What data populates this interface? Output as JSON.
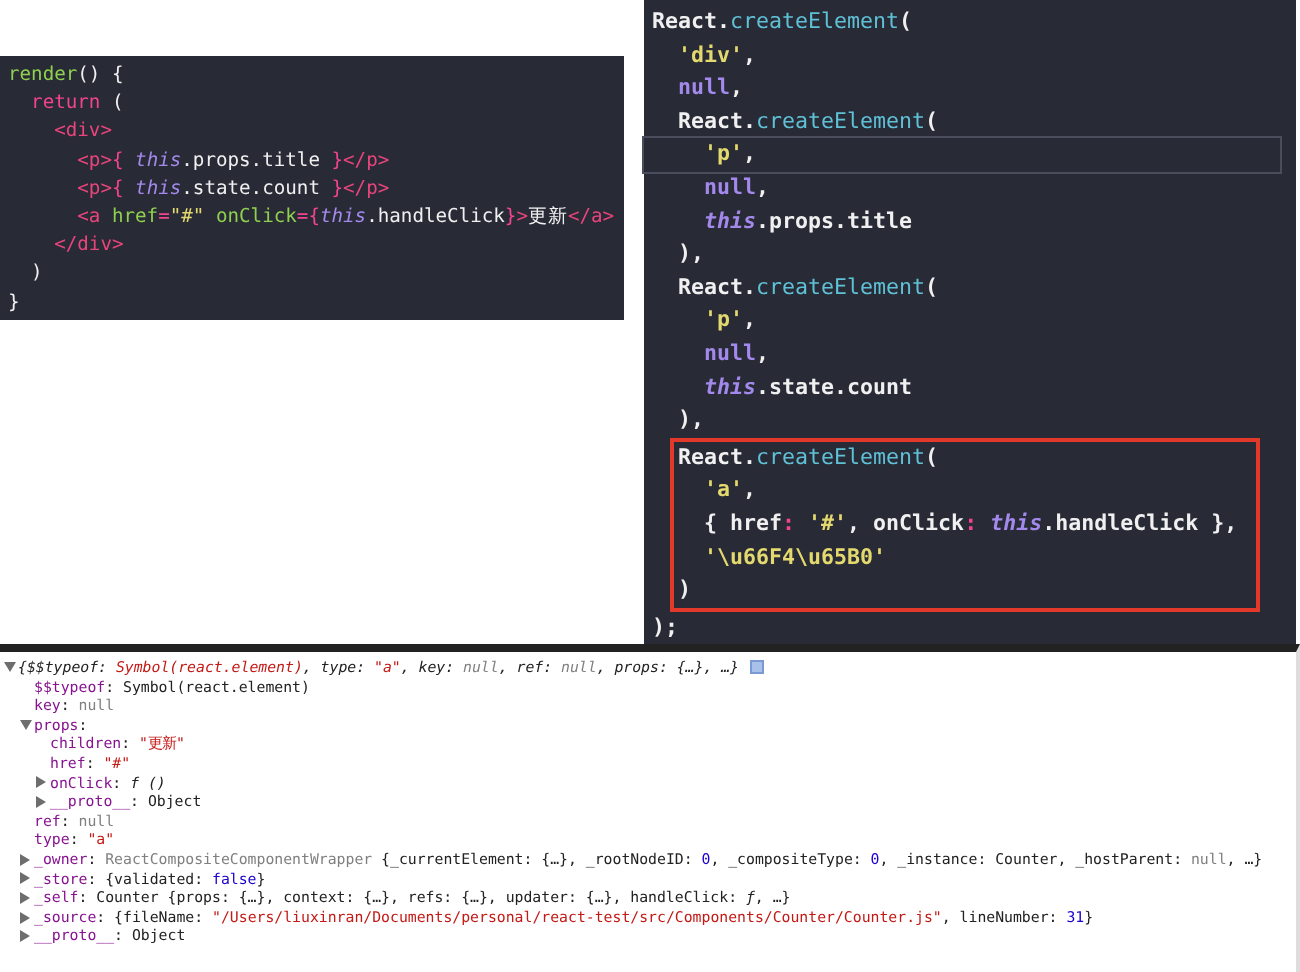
{
  "jsx_code": {
    "lines": [
      [
        {
          "kind": "f",
          "text": "render"
        },
        {
          "kind": "p",
          "text": "() {"
        }
      ],
      [
        {
          "kind": "k",
          "text": "  return"
        },
        {
          "kind": "p",
          "text": " ("
        }
      ],
      [
        {
          "kind": "t",
          "text": "    <div>"
        }
      ],
      [
        {
          "kind": "t",
          "text": "      <p>"
        },
        {
          "kind": "k",
          "text": "{ "
        },
        {
          "kind": "b",
          "text": "this"
        },
        {
          "kind": "p",
          "text": ".props.title "
        },
        {
          "kind": "k",
          "text": "}"
        },
        {
          "kind": "t",
          "text": "</p>"
        }
      ],
      [
        {
          "kind": "t",
          "text": "      <p>"
        },
        {
          "kind": "k",
          "text": "{ "
        },
        {
          "kind": "b",
          "text": "this"
        },
        {
          "kind": "p",
          "text": ".state.count "
        },
        {
          "kind": "k",
          "text": "}"
        },
        {
          "kind": "t",
          "text": "</p>"
        }
      ],
      [
        {
          "kind": "t",
          "text": "      <a "
        },
        {
          "kind": "a",
          "text": "href"
        },
        {
          "kind": "k",
          "text": "="
        },
        {
          "kind": "s",
          "text": "\"#\" "
        },
        {
          "kind": "a",
          "text": "onClick"
        },
        {
          "kind": "k",
          "text": "={"
        },
        {
          "kind": "b",
          "text": "this"
        },
        {
          "kind": "p",
          "text": ".handleClick"
        },
        {
          "kind": "k",
          "text": "}"
        },
        {
          "kind": "t",
          "text": ">"
        },
        {
          "kind": "p",
          "text": "更新"
        },
        {
          "kind": "t",
          "text": "</a>"
        }
      ],
      [
        {
          "kind": "t",
          "text": "    </div>"
        }
      ],
      [
        {
          "kind": "p",
          "text": "  )"
        }
      ],
      [
        {
          "kind": "p",
          "text": "}"
        }
      ]
    ]
  },
  "compiled_code": {
    "lines_before": [
      {
        "current": false,
        "tokens": [
          {
            "kind": "p",
            "text": "React."
          },
          {
            "kind": "c",
            "text": "createElement"
          },
          {
            "kind": "p",
            "text": "("
          }
        ]
      },
      {
        "current": false,
        "tokens": [
          {
            "kind": "s",
            "text": "  'div'"
          },
          {
            "kind": "p",
            "text": ","
          }
        ]
      },
      {
        "current": false,
        "tokens": [
          {
            "kind": "n",
            "text": "  null"
          },
          {
            "kind": "p",
            "text": ","
          }
        ]
      },
      {
        "current": false,
        "tokens": [
          {
            "kind": "p",
            "text": "  React."
          },
          {
            "kind": "c",
            "text": "createElement"
          },
          {
            "kind": "p",
            "text": "("
          }
        ]
      },
      {
        "current": true,
        "tokens": [
          {
            "kind": "s",
            "text": "    'p'"
          },
          {
            "kind": "p",
            "text": ","
          }
        ]
      },
      {
        "current": false,
        "tokens": [
          {
            "kind": "n",
            "text": "    null"
          },
          {
            "kind": "p",
            "text": ","
          }
        ]
      },
      {
        "current": false,
        "tokens": [
          {
            "kind": "b",
            "text": "    this"
          },
          {
            "kind": "p",
            "text": ".props.title"
          }
        ]
      },
      {
        "current": false,
        "tokens": [
          {
            "kind": "p",
            "text": "  ),"
          }
        ]
      },
      {
        "current": false,
        "tokens": [
          {
            "kind": "p",
            "text": "  React."
          },
          {
            "kind": "c",
            "text": "createElement"
          },
          {
            "kind": "p",
            "text": "("
          }
        ]
      },
      {
        "current": false,
        "tokens": [
          {
            "kind": "s",
            "text": "    'p'"
          },
          {
            "kind": "p",
            "text": ","
          }
        ]
      },
      {
        "current": false,
        "tokens": [
          {
            "kind": "n",
            "text": "    null"
          },
          {
            "kind": "p",
            "text": ","
          }
        ]
      },
      {
        "current": false,
        "tokens": [
          {
            "kind": "b",
            "text": "    this"
          },
          {
            "kind": "p",
            "text": ".state.count"
          }
        ]
      },
      {
        "current": false,
        "tokens": [
          {
            "kind": "p",
            "text": "  ),"
          }
        ]
      }
    ],
    "boxed_lines": [
      {
        "current": false,
        "tokens": [
          {
            "kind": "p",
            "text": "React."
          },
          {
            "kind": "c",
            "text": "createElement"
          },
          {
            "kind": "p",
            "text": "("
          }
        ]
      },
      {
        "current": false,
        "tokens": [
          {
            "kind": "s",
            "text": "  'a'"
          },
          {
            "kind": "p",
            "text": ","
          }
        ]
      },
      {
        "current": false,
        "tokens": [
          {
            "kind": "p",
            "text": "  { href"
          },
          {
            "kind": "k",
            "text": ": "
          },
          {
            "kind": "s",
            "text": "'#'"
          },
          {
            "kind": "p",
            "text": ", onClick"
          },
          {
            "kind": "k",
            "text": ": "
          },
          {
            "kind": "b",
            "text": "this"
          },
          {
            "kind": "p",
            "text": ".handleClick },"
          }
        ]
      },
      {
        "current": false,
        "tokens": [
          {
            "kind": "s",
            "text": "  '\\u66F4\\u65B0'"
          }
        ]
      },
      {
        "current": false,
        "tokens": [
          {
            "kind": "p",
            "text": ")"
          }
        ]
      }
    ],
    "lines_after": [
      {
        "current": false,
        "tokens": [
          {
            "kind": "p",
            "text": ");"
          }
        ]
      }
    ]
  },
  "console": {
    "tree": [
      {
        "kind": "branch",
        "expanded": true,
        "italic": true,
        "info_badge": true,
        "tokens": [
          {
            "kind": "p",
            "text": "{$$typeof: "
          },
          {
            "kind": "s",
            "text": "Symbol(react.element)"
          },
          {
            "kind": "p",
            "text": ", type: "
          },
          {
            "kind": "s",
            "text": "\"a\""
          },
          {
            "kind": "p",
            "text": ", key: "
          },
          {
            "kind": "n",
            "text": "null"
          },
          {
            "kind": "p",
            "text": ", ref: "
          },
          {
            "kind": "n",
            "text": "null"
          },
          {
            "kind": "p",
            "text": ", props: {…}, …}"
          }
        ],
        "children": [
          {
            "kind": "leaf",
            "tokens": [
              {
                "kind": "k",
                "text": "$$typeof"
              },
              {
                "kind": "p",
                "text": ": Symbol(react.element)"
              }
            ]
          },
          {
            "kind": "leaf",
            "tokens": [
              {
                "kind": "k",
                "text": "key"
              },
              {
                "kind": "p",
                "text": ": "
              },
              {
                "kind": "n",
                "text": "null"
              }
            ]
          },
          {
            "kind": "branch",
            "expanded": true,
            "tokens": [
              {
                "kind": "k",
                "text": "props"
              },
              {
                "kind": "p",
                "text": ":"
              }
            ],
            "children": [
              {
                "kind": "leaf",
                "tokens": [
                  {
                    "kind": "k",
                    "text": "children"
                  },
                  {
                    "kind": "p",
                    "text": ": "
                  },
                  {
                    "kind": "s",
                    "text": "\"更新\""
                  }
                ]
              },
              {
                "kind": "leaf",
                "tokens": [
                  {
                    "kind": "k",
                    "text": "href"
                  },
                  {
                    "kind": "p",
                    "text": ": "
                  },
                  {
                    "kind": "s",
                    "text": "\"#\""
                  }
                ]
              },
              {
                "kind": "branch",
                "expanded": false,
                "tokens": [
                  {
                    "kind": "k",
                    "text": "onClick"
                  },
                  {
                    "kind": "p",
                    "text": ": "
                  },
                  {
                    "kind": "f",
                    "text": "f ()"
                  }
                ]
              },
              {
                "kind": "branch",
                "expanded": false,
                "tokens": [
                  {
                    "kind": "k",
                    "text": "__proto__"
                  },
                  {
                    "kind": "p",
                    "text": ": Object"
                  }
                ]
              }
            ]
          },
          {
            "kind": "leaf",
            "tokens": [
              {
                "kind": "k",
                "text": "ref"
              },
              {
                "kind": "p",
                "text": ": "
              },
              {
                "kind": "n",
                "text": "null"
              }
            ]
          },
          {
            "kind": "leaf",
            "tokens": [
              {
                "kind": "k",
                "text": "type"
              },
              {
                "kind": "p",
                "text": ": "
              },
              {
                "kind": "s",
                "text": "\"a\""
              }
            ]
          },
          {
            "kind": "branch",
            "expanded": false,
            "tokens": [
              {
                "kind": "k",
                "text": "_owner"
              },
              {
                "kind": "p",
                "text": ": "
              },
              {
                "kind": "n",
                "text": "ReactCompositeComponentWrapper"
              },
              {
                "kind": "p",
                "text": " {_currentElement: {…}, _rootNodeID: "
              },
              {
                "kind": "u",
                "text": "0"
              },
              {
                "kind": "p",
                "text": ", _compositeType: "
              },
              {
                "kind": "u",
                "text": "0"
              },
              {
                "kind": "p",
                "text": ", _instance: Counter, _hostParent: "
              },
              {
                "kind": "n",
                "text": "null"
              },
              {
                "kind": "p",
                "text": ", …}"
              }
            ]
          },
          {
            "kind": "branch",
            "expanded": false,
            "tokens": [
              {
                "kind": "k",
                "text": "_store"
              },
              {
                "kind": "p",
                "text": ": {validated: "
              },
              {
                "kind": "u",
                "text": "false"
              },
              {
                "kind": "p",
                "text": "}"
              }
            ]
          },
          {
            "kind": "branch",
            "expanded": false,
            "tokens": [
              {
                "kind": "k",
                "text": "_self"
              },
              {
                "kind": "p",
                "text": ": Counter {props: {…}, context: {…}, refs: {…}, updater: {…}, handleClick: "
              },
              {
                "kind": "f",
                "text": "ƒ"
              },
              {
                "kind": "p",
                "text": ", …}"
              }
            ]
          },
          {
            "kind": "branch",
            "expanded": false,
            "tokens": [
              {
                "kind": "k",
                "text": "_source"
              },
              {
                "kind": "p",
                "text": ": {fileName: "
              },
              {
                "kind": "s",
                "text": "\"/Users/liuxinran/Documents/personal/react-test/src/Components/Counter/Counter.js\""
              },
              {
                "kind": "p",
                "text": ", lineNumber: "
              },
              {
                "kind": "u",
                "text": "31"
              },
              {
                "kind": "p",
                "text": "}"
              }
            ]
          },
          {
            "kind": "branch",
            "expanded": false,
            "tokens": [
              {
                "kind": "k",
                "text": "__proto__"
              },
              {
                "kind": "p",
                "text": ": Object"
              }
            ]
          }
        ]
      }
    ]
  }
}
